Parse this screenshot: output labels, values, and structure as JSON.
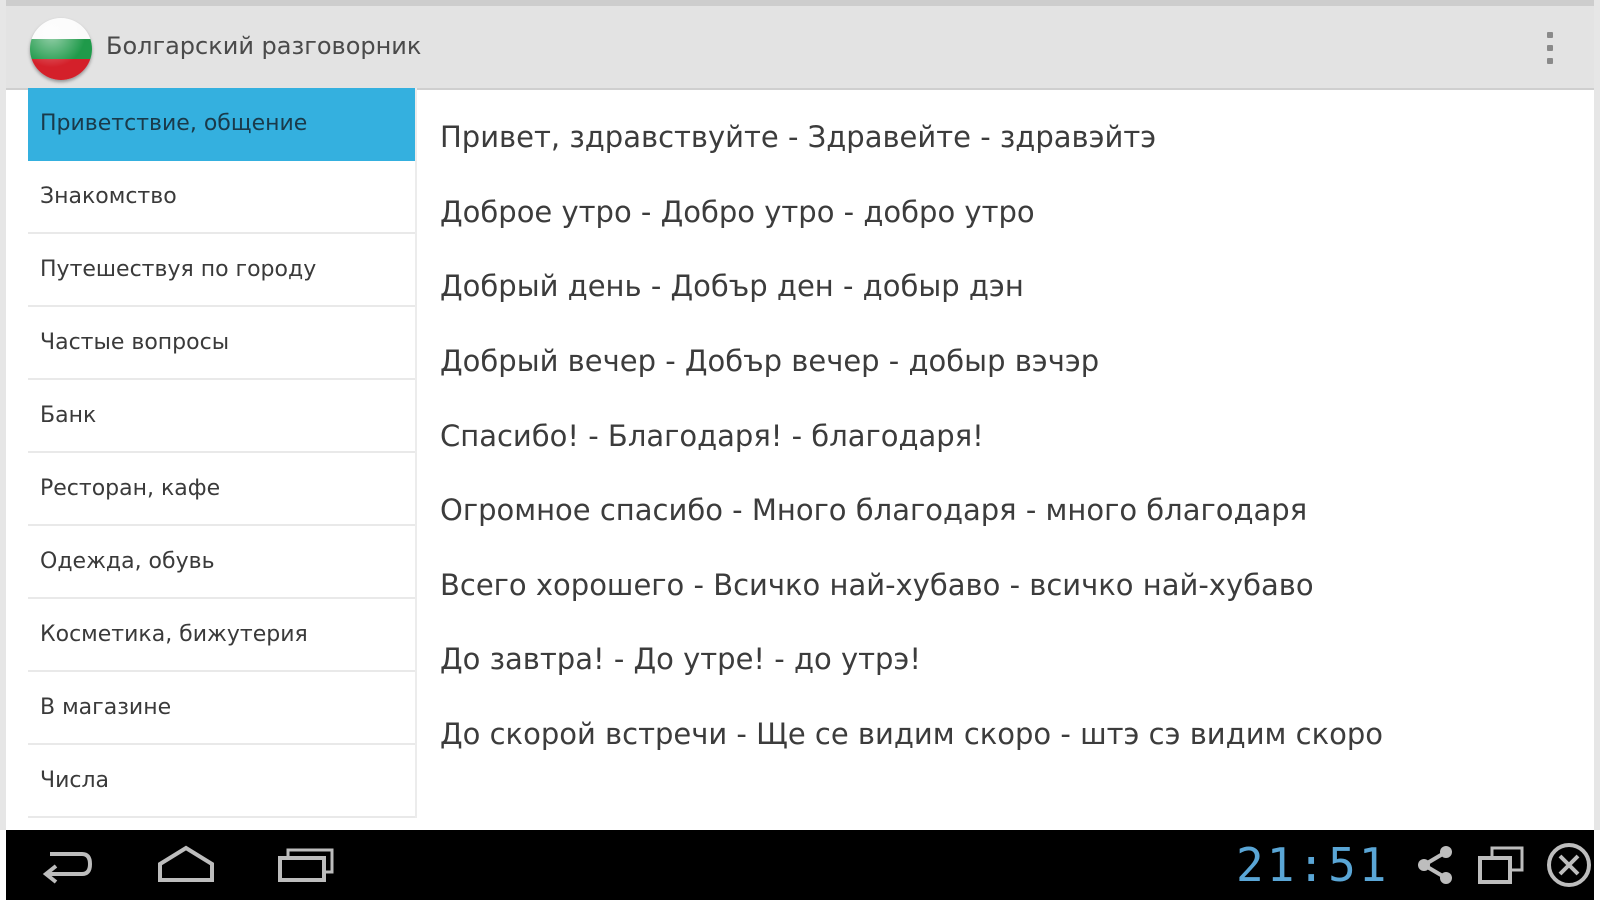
{
  "app": {
    "title": "Болгарский разговорник"
  },
  "sidebar": {
    "items": [
      {
        "label": "Приветствие, общение",
        "selected": true
      },
      {
        "label": "Знакомство",
        "selected": false
      },
      {
        "label": "Путешествуя по городу",
        "selected": false
      },
      {
        "label": "Частые вопросы",
        "selected": false
      },
      {
        "label": "Банк",
        "selected": false
      },
      {
        "label": "Ресторан, кафе",
        "selected": false
      },
      {
        "label": "Одежда, обувь",
        "selected": false
      },
      {
        "label": "Косметика, бижутерия",
        "selected": false
      },
      {
        "label": "В магазине",
        "selected": false
      },
      {
        "label": "Числа",
        "selected": false
      }
    ]
  },
  "phrases": [
    "Привет, здравствуйте - Здравейте - здравэйтэ",
    "Доброе утро - Добро утро - добро утро",
    "Добрый день - Добър ден - добыр дэн",
    "Добрый вечер - Добър вечер - добыр вэчэр",
    "Спасибо! - Благодаря! - благодаря!",
    "Огромное спасибо - Много благодаря - много благодаря",
    "Всего хорошего - Всичко най-хубаво - всичко най-хубаво",
    "До завтра! - До утре! - до утрэ!",
    "До скорой встречи - Ще се видим скоро - штэ сэ видим скоро"
  ],
  "status": {
    "time": "21:51"
  },
  "icons": {
    "app": "bulgarian-flag-icon",
    "menu": "overflow-menu-icon",
    "back": "back-icon",
    "home": "home-icon",
    "recent": "recent-apps-icon",
    "share": "share-icon",
    "window": "window-icon",
    "close": "close-icon"
  },
  "colors": {
    "selected": "#34b0df",
    "clock": "#5aa6d6",
    "flag_white": "#fbfbfb",
    "flag_green": "#1f9a4a",
    "flag_red": "#d4202a"
  }
}
